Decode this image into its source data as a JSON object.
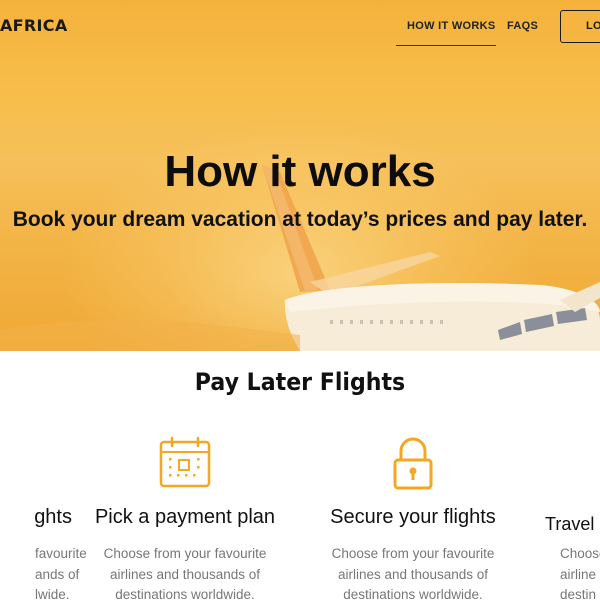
{
  "brand": {
    "logo_text": "AFRICA"
  },
  "nav": {
    "links": [
      {
        "label": "HOW IT WORKS",
        "active": true
      },
      {
        "label": "FAQS",
        "active": false
      }
    ],
    "login_label": "LOGIN"
  },
  "hero": {
    "title": "How it works",
    "subtitle": "Book your dream vacation at today’s prices and pay later."
  },
  "section": {
    "title": "Pay Later Flights",
    "cards": [
      {
        "title": "ghts",
        "desc": "favourite ands of lwide.",
        "icon": "none"
      },
      {
        "title": "Pick a payment plan",
        "desc": "Choose from your favourite airlines and thousands of destinations worldwide.",
        "icon": "calendar-icon"
      },
      {
        "title": "Secure your flights",
        "desc": "Choose from your favourite airlines and thousands of destinations worldwide.",
        "icon": "lock-icon"
      },
      {
        "title": "Travel",
        "desc": "Choose airline destin",
        "icon": "none"
      }
    ]
  },
  "colors": {
    "accent": "#f5a623",
    "hero_top": "#f4b23c",
    "text_dark": "#111111",
    "text_muted": "#777777"
  }
}
